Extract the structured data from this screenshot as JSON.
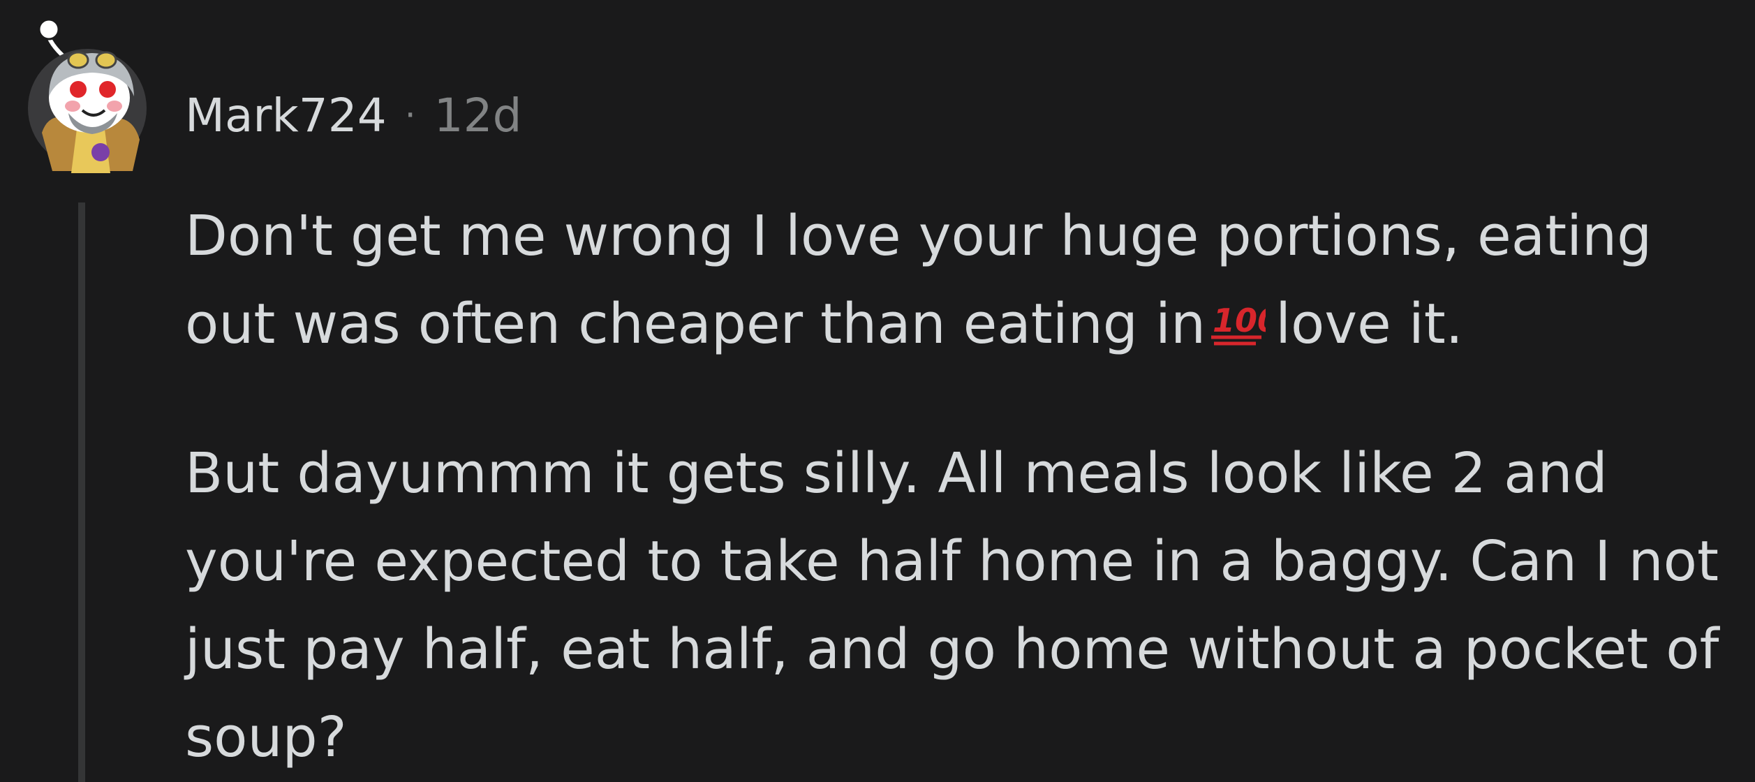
{
  "comment": {
    "author": "Mark724",
    "separator": "·",
    "age": "12d",
    "avatar_icon": "snoo-avatar-icon",
    "paragraphs": [
      {
        "before_emoji": "Don't get me wrong I love your huge portions, eating out was often cheaper than eating in",
        "emoji": "hundred-points-emoji",
        "after_emoji": "love it."
      },
      {
        "text": "But dayummm it gets silly. All meals look like 2 and you're expected to take half home in a baggy. Can I not just pay half, eat half, and go home without a pocket of soup?"
      }
    ]
  },
  "colors": {
    "background": "#1a1a1b",
    "text": "#d7dadc",
    "meta_text": "#818384",
    "thread_line": "#343536",
    "emoji_red": "#d8262c"
  }
}
